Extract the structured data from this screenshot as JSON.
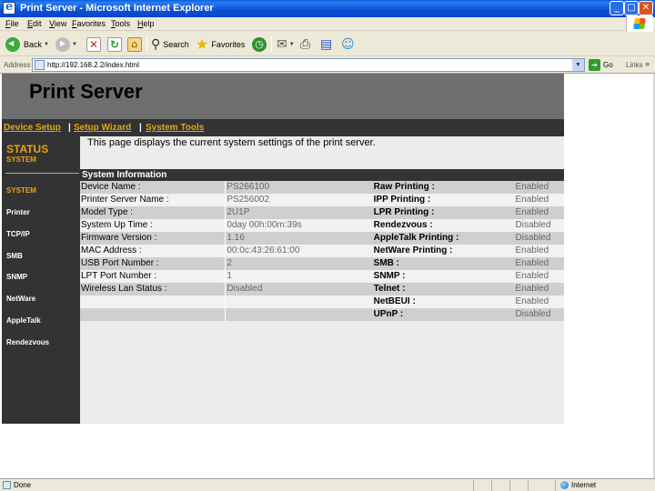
{
  "window": {
    "title": "Print Server - Microsoft Internet Explorer",
    "minimize": "_",
    "maximize": "□",
    "close": "✕"
  },
  "menu": [
    "File",
    "Edit",
    "View",
    "Favorites",
    "Tools",
    "Help"
  ],
  "toolbar": {
    "back_label": "Back",
    "search_label": "Search",
    "favorites_label": "Favorites"
  },
  "address": {
    "label": "Address",
    "url": "http://192.168.2.2/index.html",
    "go_label": "Go",
    "links_label": "Links"
  },
  "page": {
    "header_title": "Print Server",
    "nav": [
      "Device Setup",
      "Setup Wizard",
      "System Tools"
    ],
    "nav_separator": "|",
    "sidebar": {
      "status_title": "STATUS",
      "status_subtitle": "SYSTEM",
      "items": [
        "SYSTEM",
        "Printer",
        "TCP/IP",
        "SMB",
        "SNMP",
        "NetWare",
        "AppleTalk",
        "Rendezvous"
      ],
      "active_item": "SYSTEM"
    },
    "intro": "This page displays the current system settings of the print server.",
    "section_title": "System Information",
    "rows": [
      {
        "k": "Device Name :",
        "v": "PS266100",
        "k2": "Raw Printing :",
        "v2": "Enabled"
      },
      {
        "k": "Printer Server Name :",
        "v": "PS256002",
        "k2": "IPP Printing :",
        "v2": "Enabled"
      },
      {
        "k": "Model Type :",
        "v": "2U1P",
        "k2": "LPR Printing :",
        "v2": "Enabled"
      },
      {
        "k": "System Up Time :",
        "v": "0day 00h:00m:39s",
        "k2": "Rendezvous :",
        "v2": "Disabled"
      },
      {
        "k": "Firmware Version :",
        "v": "1.16",
        "k2": "AppleTalk Printing :",
        "v2": "Disabled"
      },
      {
        "k": "MAC Address :",
        "v": "00:0c:43:26:61:00",
        "k2": "NetWare Printing :",
        "v2": "Enabled"
      },
      {
        "k": "USB Port Number :",
        "v": "2",
        "k2": "SMB :",
        "v2": "Enabled"
      },
      {
        "k": "LPT Port Number :",
        "v": "1",
        "k2": "SNMP :",
        "v2": "Enabled"
      },
      {
        "k": "Wireless Lan Status :",
        "v": "Disabled",
        "k2": "Telnet :",
        "v2": "Enabled"
      },
      {
        "k": "",
        "v": "",
        "k2": "NetBEUI :",
        "v2": "Enabled"
      },
      {
        "k": "",
        "v": "",
        "k2": "UPnP :",
        "v2": "Disabled"
      }
    ]
  },
  "statusbar": {
    "status": "Done",
    "zone": "Internet"
  },
  "colors": {
    "accent_orange": "#e6a417",
    "sidebar_bg": "#333333",
    "header_bg": "#6e6e6e",
    "xp_blue": "#0a5fdc"
  },
  "icons": [
    "ie-icon",
    "back-icon",
    "forward-icon",
    "stop-icon",
    "refresh-icon",
    "home-icon",
    "search-icon",
    "favorites-star-icon",
    "history-icon",
    "mail-icon",
    "print-icon",
    "edit-icon",
    "messenger-icon",
    "page-icon",
    "go-arrow-icon",
    "windows-logo-icon",
    "internet-globe-icon"
  ]
}
